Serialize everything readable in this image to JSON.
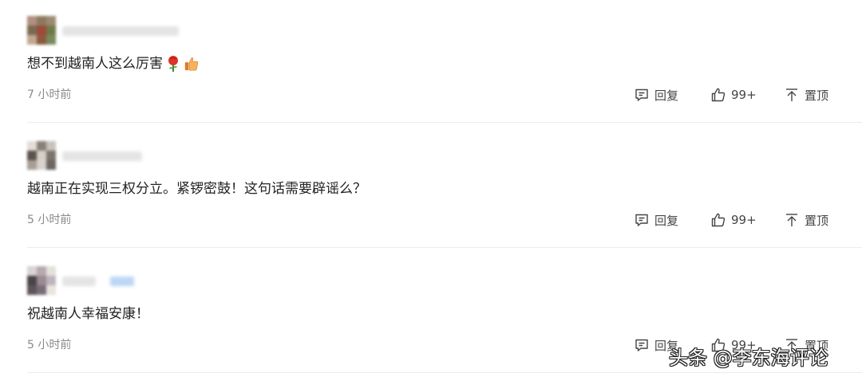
{
  "comments": [
    {
      "text": "想不到越南人这么厉害",
      "emoji": [
        "rose-icon",
        "thumbs-up-icon"
      ],
      "time": "7 小时前",
      "reply_label": "回复",
      "like_count": "99+",
      "pin_label": "置顶"
    },
    {
      "text": "越南正在实现三权分立。紧锣密鼓！这句话需要辟谣么？",
      "time": "5 小时前",
      "reply_label": "回复",
      "like_count": "99+",
      "pin_label": "置顶"
    },
    {
      "text": "祝越南人幸福安康！",
      "time": "5 小时前",
      "reply_label": "回复",
      "like_count": "99+",
      "pin_label": "置顶"
    }
  ],
  "watermark": "头条 @李东海评论",
  "colors": {
    "text": "#222222",
    "muted": "#8a8a8a",
    "action": "#444444",
    "divider": "#ececec"
  }
}
